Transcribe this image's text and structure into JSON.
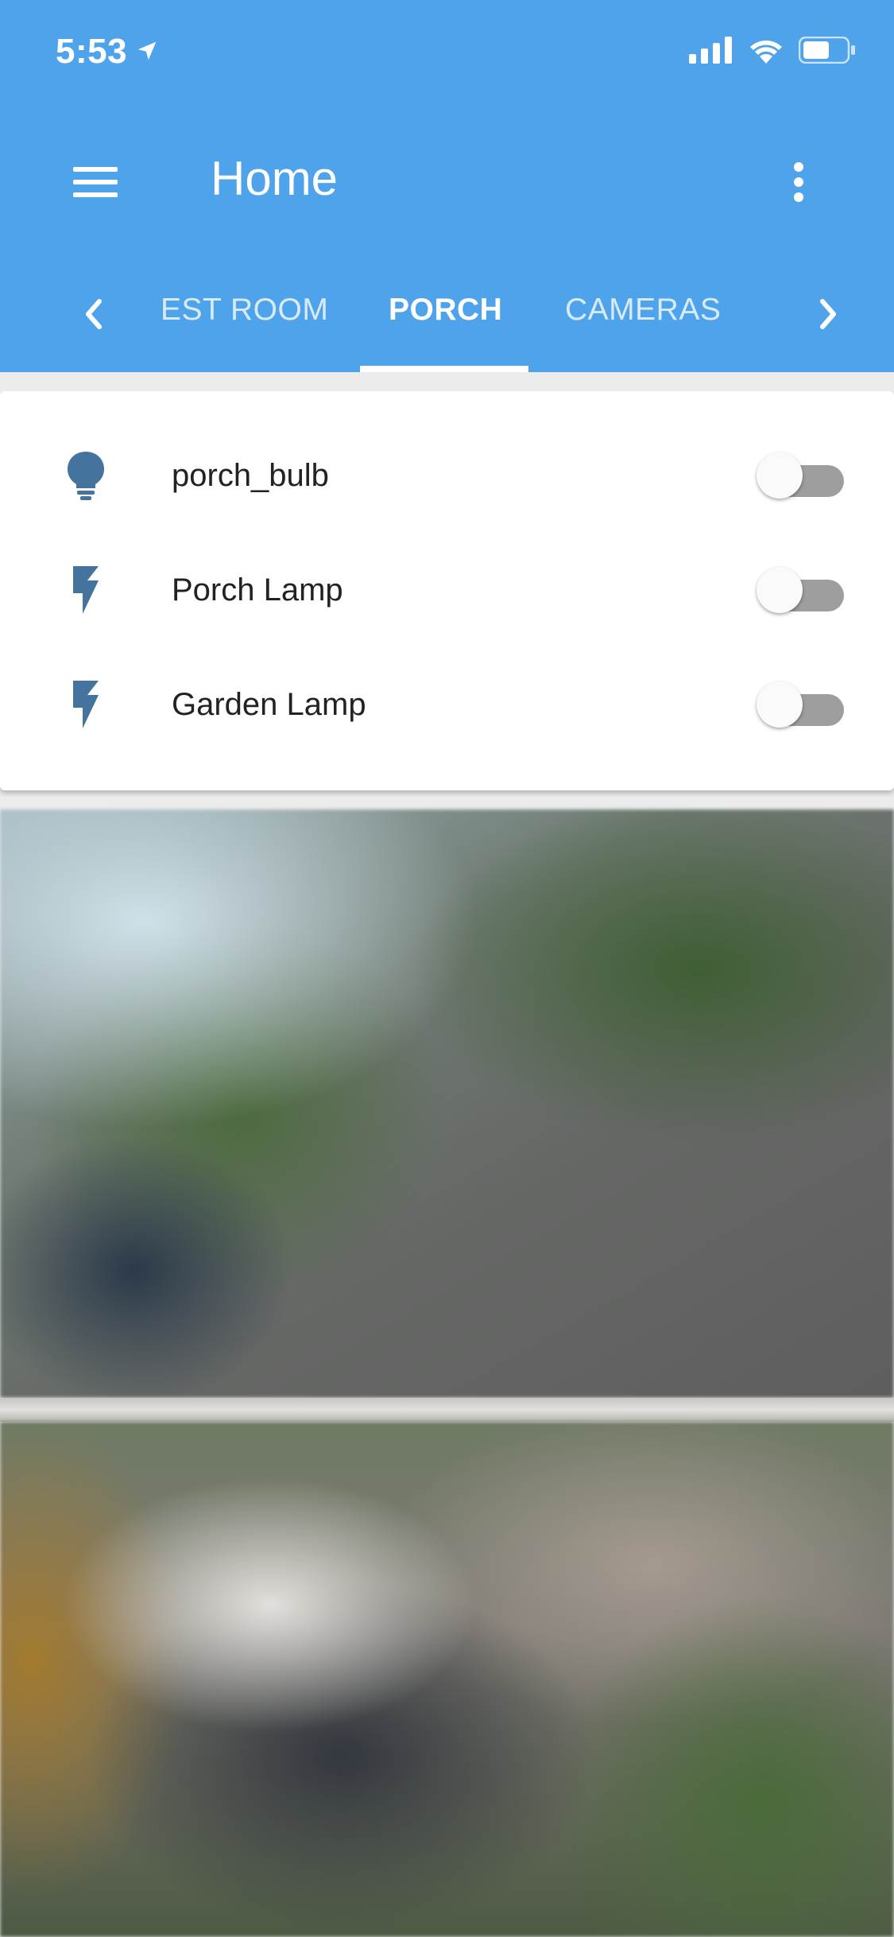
{
  "status_bar": {
    "time": "5:53",
    "icons": [
      "location-arrow-icon",
      "signal-icon",
      "wifi-icon",
      "battery-icon"
    ]
  },
  "toolbar": {
    "title": "Home",
    "menu_icon": "hamburger-menu-icon",
    "overflow_icon": "more-vert-icon"
  },
  "tabs": {
    "items": [
      {
        "label": "EST ROOM",
        "active": false
      },
      {
        "label": "PORCH",
        "active": true
      },
      {
        "label": "CAMERAS",
        "active": false
      }
    ],
    "left_arrow": "chevron-left-icon",
    "right_arrow": "chevron-right-icon"
  },
  "entities": [
    {
      "name": "porch_bulb",
      "icon": "lightbulb-icon",
      "state": "off"
    },
    {
      "name": "Porch Lamp",
      "icon": "flash-icon",
      "state": "off"
    },
    {
      "name": "Garden Lamp",
      "icon": "flash-icon",
      "state": "off"
    }
  ],
  "colors": {
    "header": "#4fa3ea",
    "icon": "#44739e",
    "toggle_off_track": "#9e9e9e"
  }
}
